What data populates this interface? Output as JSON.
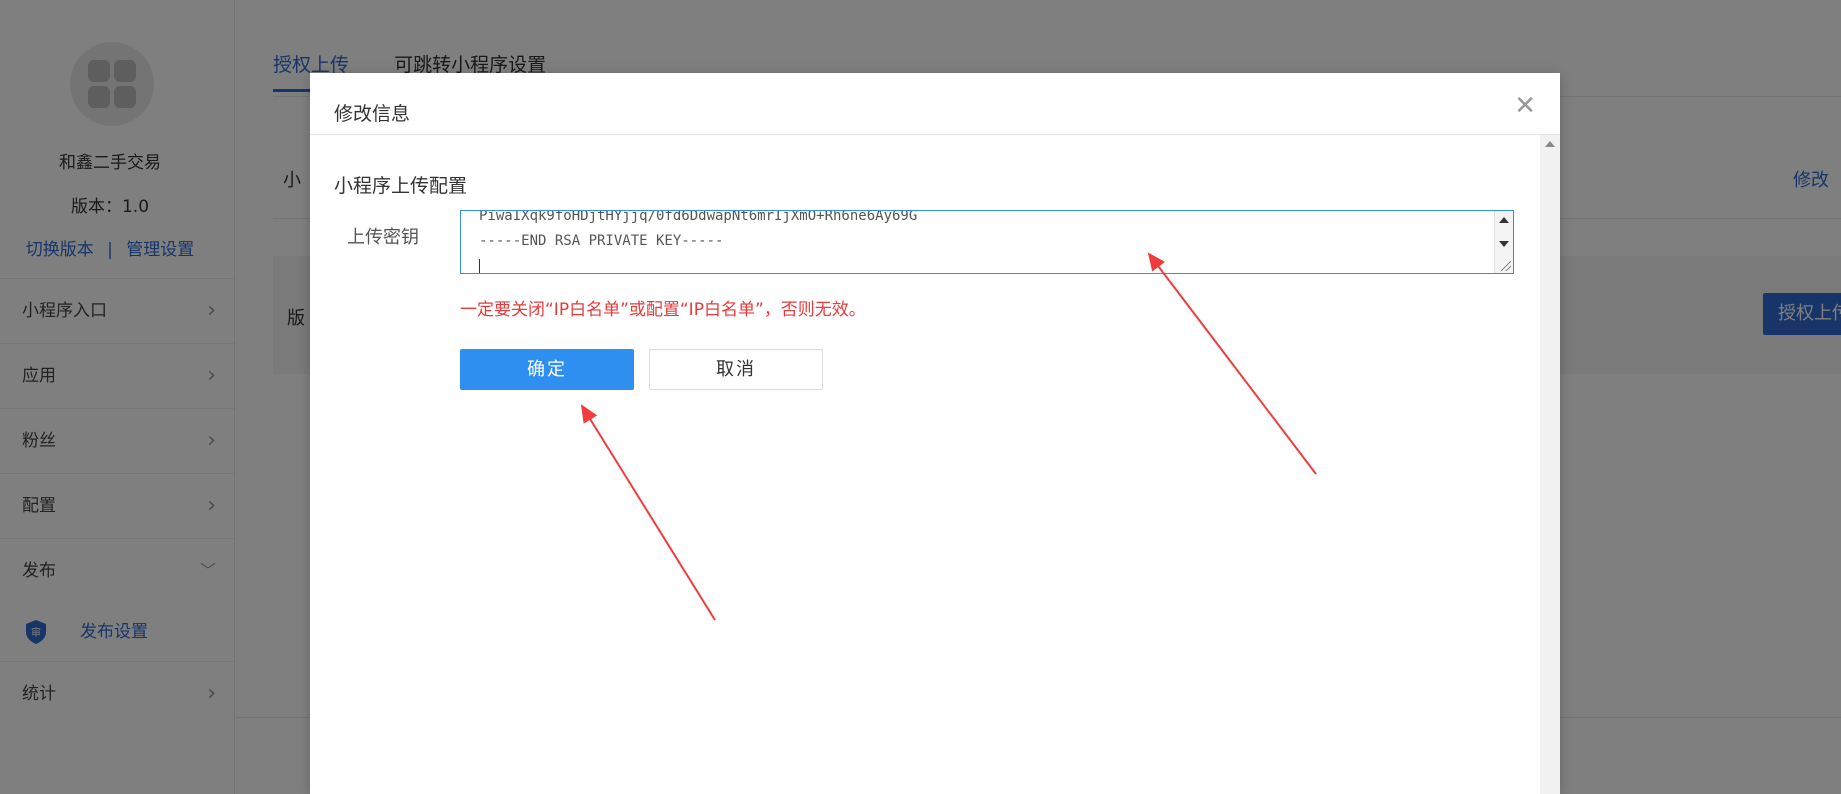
{
  "sidebar": {
    "app_name": "和鑫二手交易",
    "version": "版本：1.0",
    "switch_version": "切换版本",
    "divider": "|",
    "manage_settings": "管理设置",
    "menu": [
      {
        "label": "小程序入口"
      },
      {
        "label": "应用"
      },
      {
        "label": "粉丝"
      },
      {
        "label": "配置"
      },
      {
        "label": "发布"
      },
      {
        "label": "统计"
      }
    ],
    "sub_item": {
      "label": "发布设置",
      "icon": "shield-icon",
      "icon_text": "审"
    }
  },
  "main": {
    "tabs": [
      {
        "label": "授权上传"
      },
      {
        "label": "可跳转小程序设置"
      }
    ],
    "row1_label": "小",
    "row1_edit": "修改",
    "panel_label": "版",
    "panel_button": "授权上传"
  },
  "modal": {
    "title": "修改信息",
    "close_icon": "close-icon",
    "section_title": "小程序上传配置",
    "field_label": "上传密钥",
    "key_line_1": "PiwaIXqk9foHDjtHYjjq/0fd6DdwapNt6mrIjXmO+Rh6ne6Ay69G",
    "key_line_2": "-----END RSA PRIVATE KEY-----",
    "warning": "一定要关闭“IP白名单”或配置“IP白名单”，否则无效。",
    "ok_label": "确定",
    "cancel_label": "取消"
  },
  "colors": {
    "accent": "#2f8ff0",
    "link": "#2f6bd0",
    "warning": "#e63b3b",
    "arrow": "#f03c3c"
  }
}
